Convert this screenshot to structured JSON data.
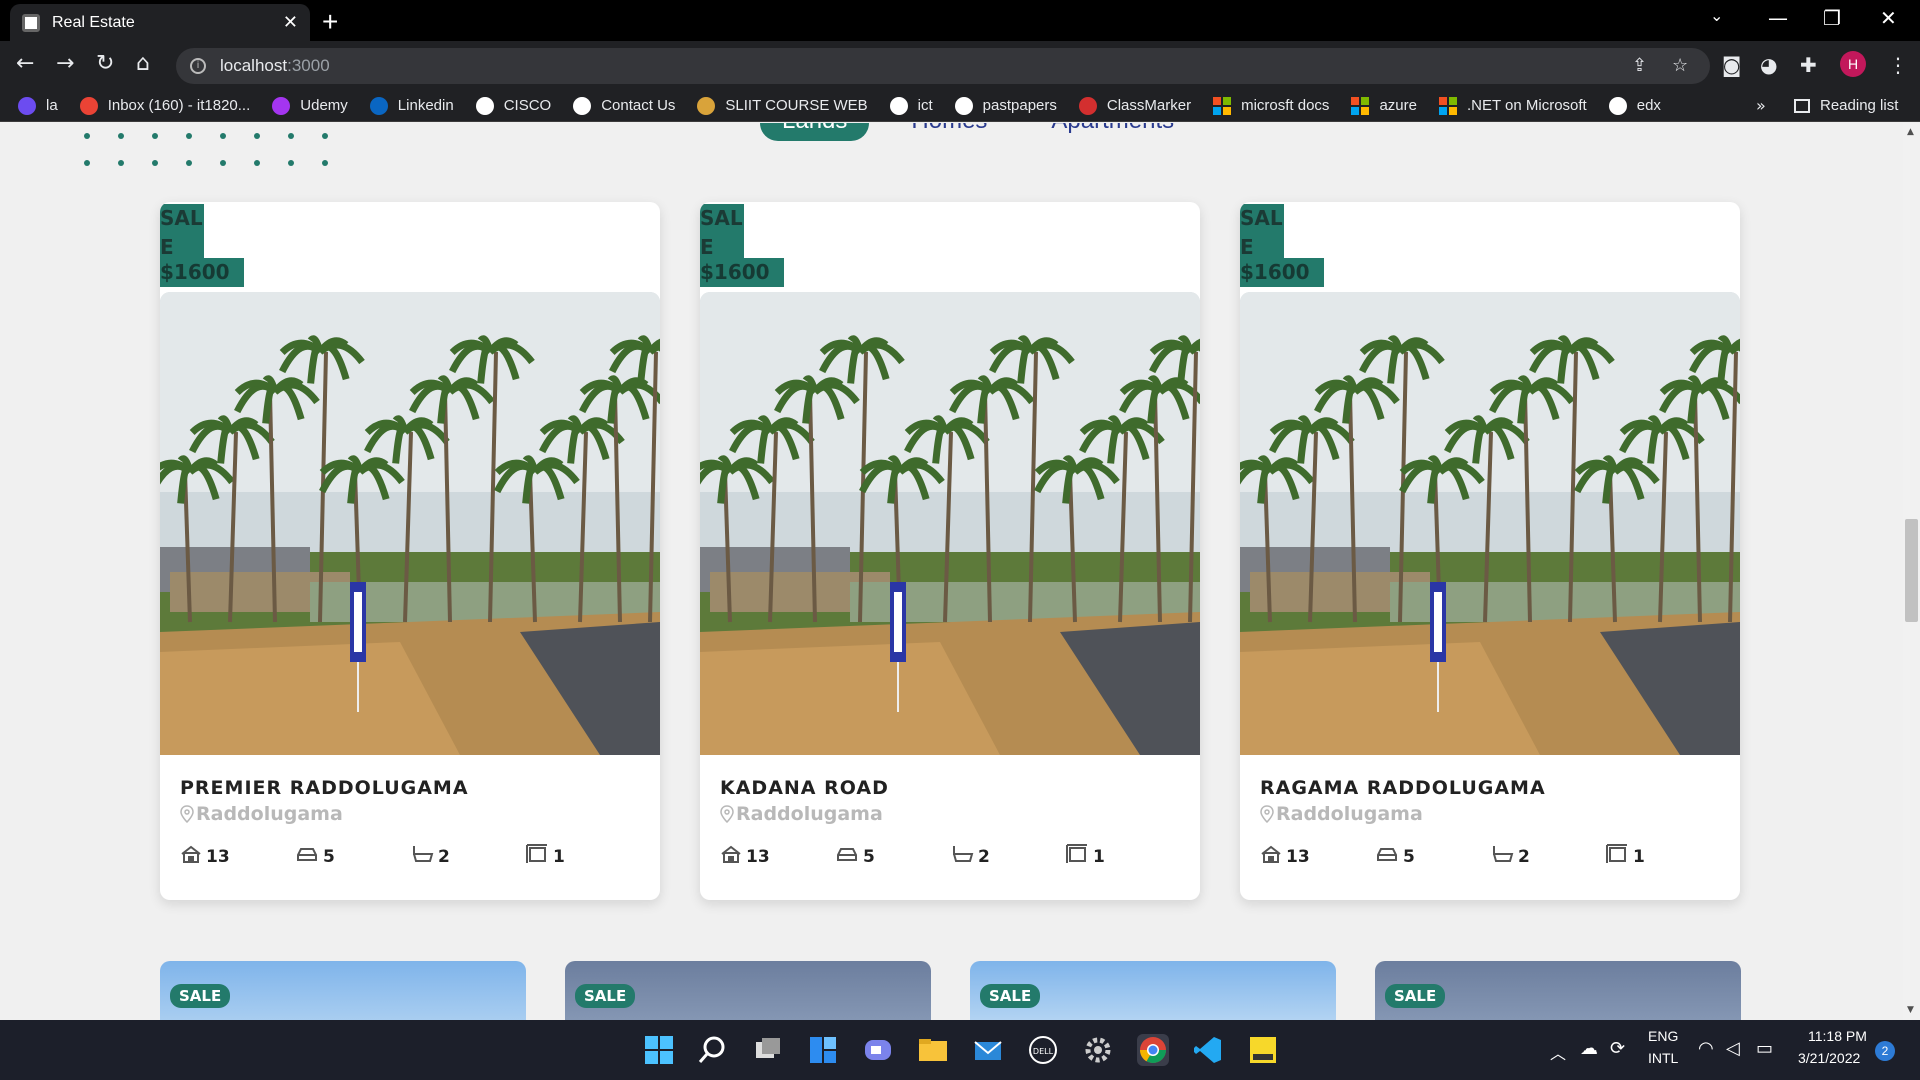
{
  "browser": {
    "tab_title": "Real Estate",
    "new_tab": "+",
    "url_host": "localhost",
    "url_port": ":3000",
    "profile_initial": "H"
  },
  "bookmarks": [
    {
      "label": "la",
      "icon": "la-icon",
      "color": "#6c4cf0"
    },
    {
      "label": "Inbox (160) - it1820...",
      "icon": "gmail-icon",
      "color": "#ea4335"
    },
    {
      "label": "Udemy",
      "icon": "udemy-icon",
      "color": "#a435f0"
    },
    {
      "label": "Linkedin",
      "icon": "linkedin-icon",
      "color": "#0a66c2"
    },
    {
      "label": "CISCO",
      "icon": "cisco-icon",
      "color": "#ffffff"
    },
    {
      "label": "Contact Us",
      "icon": "globe-icon",
      "color": "#ffffff"
    },
    {
      "label": "SLIIT COURSE WEB",
      "icon": "sliit-icon",
      "color": "#d9a33a"
    },
    {
      "label": "ict",
      "icon": "ict-icon",
      "color": "#ffffff"
    },
    {
      "label": "pastpapers",
      "icon": "pastpapers-icon",
      "color": "#ffffff"
    },
    {
      "label": "ClassMarker",
      "icon": "classmarker-icon",
      "color": "#d32f2f"
    },
    {
      "label": "microsft docs",
      "icon": "microsoft-icon",
      "color": "#f25022"
    },
    {
      "label": "azure",
      "icon": "microsoft-icon",
      "color": "#f25022"
    },
    {
      "label": ".NET on Microsoft",
      "icon": "microsoft-icon",
      "color": "#f25022"
    },
    {
      "label": "edx",
      "icon": "edx-icon",
      "color": "#ffffff"
    }
  ],
  "bookmarks_more": "»",
  "reading_list": "Reading list",
  "filter_tabs": [
    {
      "label": "Lands",
      "active": true
    },
    {
      "label": "Homes",
      "active": false
    },
    {
      "label": "Apartments",
      "active": false
    }
  ],
  "cards": [
    {
      "sale": "SALE",
      "price": "$1600",
      "title": "PREMIER RADDOLUGAMA",
      "location": "Raddolugama",
      "rooms": "13",
      "garage": "5",
      "baths": "2",
      "area": "1"
    },
    {
      "sale": "SALE",
      "price": "$1600",
      "title": "KADANA ROAD",
      "location": "Raddolugama",
      "rooms": "13",
      "garage": "5",
      "baths": "2",
      "area": "1"
    },
    {
      "sale": "SALE",
      "price": "$1600",
      "title": "RAGAMA RADDOLUGAMA",
      "location": "Raddolugama",
      "rooms": "13",
      "garage": "5",
      "baths": "2",
      "area": "1"
    }
  ],
  "second_row": [
    {
      "sale": "SALE"
    },
    {
      "sale": "SALE"
    },
    {
      "sale": "SALE"
    },
    {
      "sale": "SALE"
    }
  ],
  "tray": {
    "lang1": "ENG",
    "lang2": "INTL",
    "time": "11:18 PM",
    "date": "3/21/2022",
    "notifications": "2"
  },
  "colors": {
    "accent": "#237a6b",
    "chrome_dark": "#202124"
  }
}
